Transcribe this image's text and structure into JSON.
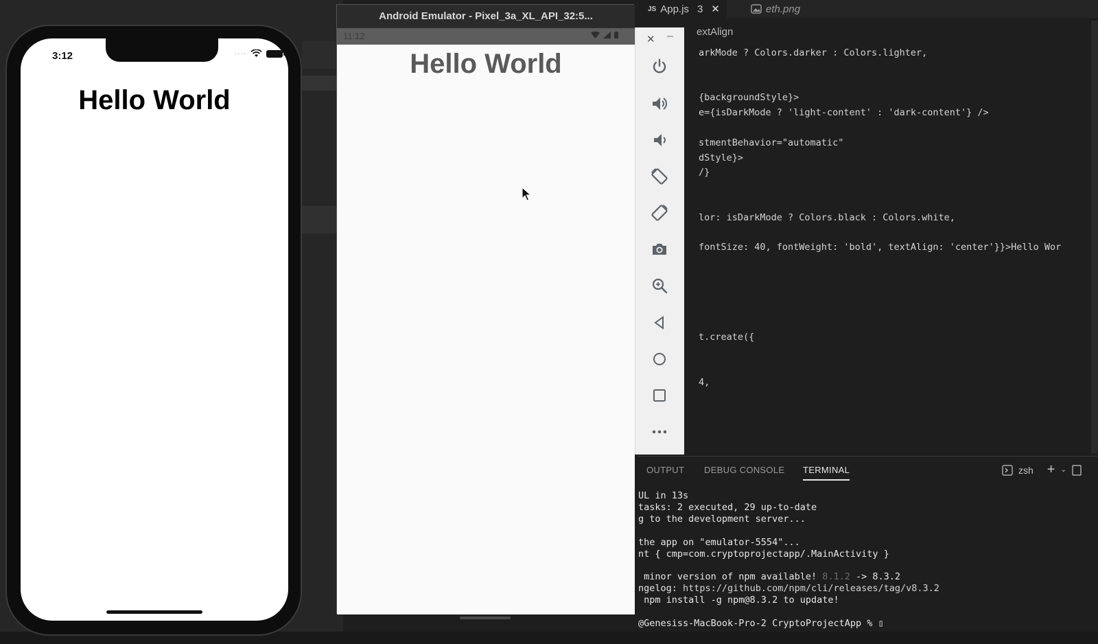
{
  "vscode": {
    "tabs": [
      {
        "tag": "JS",
        "label": "App.js",
        "count": "3",
        "close": "✕"
      },
      {
        "label": "eth.png"
      }
    ],
    "breadcrumb_fragment": "extAlign",
    "code_lines": [
      "arkMode ? Colors.darker : Colors.lighter,",
      "",
      "",
      "{backgroundStyle}>",
      "e={isDarkMode ? 'light-content' : 'dark-content'} />",
      "",
      "stmentBehavior=\"automatic\"",
      "dStyle}>",
      "/}",
      "",
      "",
      "lor: isDarkMode ? Colors.black : Colors.white,",
      "",
      "fontSize: 40, fontWeight: 'bold', textAlign: 'center'}}>Hello Wor",
      "",
      "",
      "",
      "",
      "",
      "t.create({",
      "",
      "",
      "4,"
    ],
    "panel": {
      "tabs": [
        "OUTPUT",
        "DEBUG CONSOLE",
        "TERMINAL"
      ],
      "active_tab": "TERMINAL",
      "shell": "zsh"
    },
    "terminal_lines": [
      {
        "text": "UL in 13s"
      },
      {
        "text": "tasks: 2 executed, 29 up-to-date"
      },
      {
        "text": "g to the development server..."
      },
      {
        "text": ""
      },
      {
        "text": "the app on \"emulator-5554\"..."
      },
      {
        "text": "nt { cmp=com.cryptoprojectapp/.MainActivity }"
      },
      {
        "text": ""
      },
      {
        "pre": " minor version of npm available! ",
        "dim": "8.1.2",
        "post": " -> 8.3.2"
      },
      {
        "pre": "ngelog: ",
        "link": "https://github.com/npm/cli/releases/tag/v8.3.2"
      },
      {
        "pre": " npm install -g npm@8.3.2 to update!"
      },
      {
        "text": ""
      },
      {
        "text": "@Genesiss-MacBook-Pro-2 CryptoProjectApp % ▯"
      }
    ]
  },
  "ios": {
    "time": "3:12",
    "hello": "Hello World"
  },
  "android": {
    "window_title": "Android Emulator - Pixel_3a_XL_API_32:5...",
    "time": "11:12",
    "hello": "Hello World",
    "toolbar": [
      "power-icon",
      "volume-up-icon",
      "volume-down-icon",
      "rotate-left-icon",
      "rotate-right-icon",
      "camera-icon",
      "zoom-icon",
      "back-icon",
      "home-icon",
      "overview-icon",
      "more-icon"
    ]
  },
  "colors": {
    "editor_bg": "#1e1e1e",
    "emulator_title_bg": "#2b2b2b",
    "android_status_bg": "#5d5d5d"
  }
}
